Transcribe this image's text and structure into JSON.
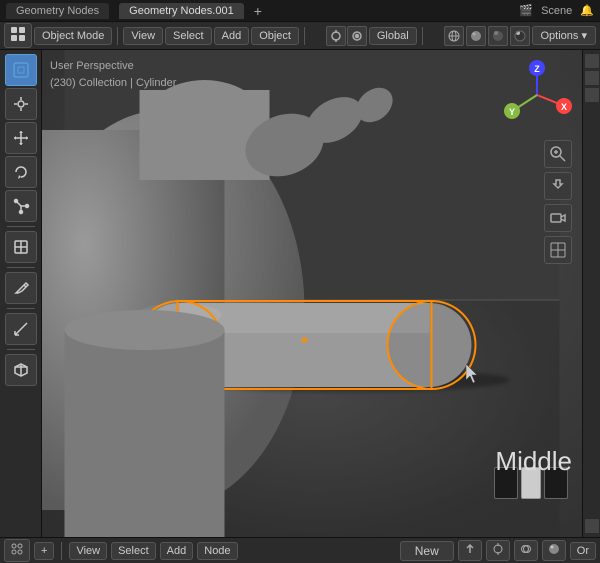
{
  "titleBar": {
    "tabs": [
      {
        "label": "Geometry Nodes",
        "active": false
      },
      {
        "label": "Geometry Nodes.001",
        "active": true
      }
    ],
    "addTab": "+",
    "sceneLabel": "Scene",
    "icons": [
      "🎬",
      "🔔"
    ]
  },
  "topToolbar": {
    "editorIcon": "⬜",
    "objectMode": "Object Mode",
    "view": "View",
    "select": "Select",
    "add": "Add",
    "object": "Object",
    "transformLabel": "⬛",
    "global": "Global",
    "options": "Options ▾"
  },
  "viewportInfo": {
    "line1": "User Perspective",
    "line2": "(230) Collection | Cylinder"
  },
  "gizmo": {
    "x": "X",
    "y": "Y",
    "z": "Z"
  },
  "middleText": "Middle",
  "shadingBoxes": [
    {
      "color": "#1a1a1a"
    },
    {
      "color": "#cccccc"
    },
    {
      "color": "#1a1a1a"
    }
  ],
  "bottomToolbar": {
    "editorIcon": "⬛",
    "addIcon": "+",
    "view": "View",
    "select": "Select",
    "add": "Add",
    "node": "Node",
    "new": "New",
    "orLabel": "Or"
  },
  "leftTools": [
    {
      "icon": "↖",
      "active": true
    },
    {
      "icon": "↔"
    },
    {
      "icon": "↺"
    },
    {
      "icon": "⤡"
    },
    {
      "separator": true
    },
    {
      "icon": "🖊"
    },
    {
      "separator": true
    },
    {
      "icon": "📐"
    },
    {
      "separator": true
    },
    {
      "icon": "⬜"
    }
  ],
  "rightGizmoTools": [
    {
      "icon": "🔍"
    },
    {
      "icon": "✋"
    },
    {
      "icon": "🎥"
    },
    {
      "icon": "⬜"
    }
  ]
}
